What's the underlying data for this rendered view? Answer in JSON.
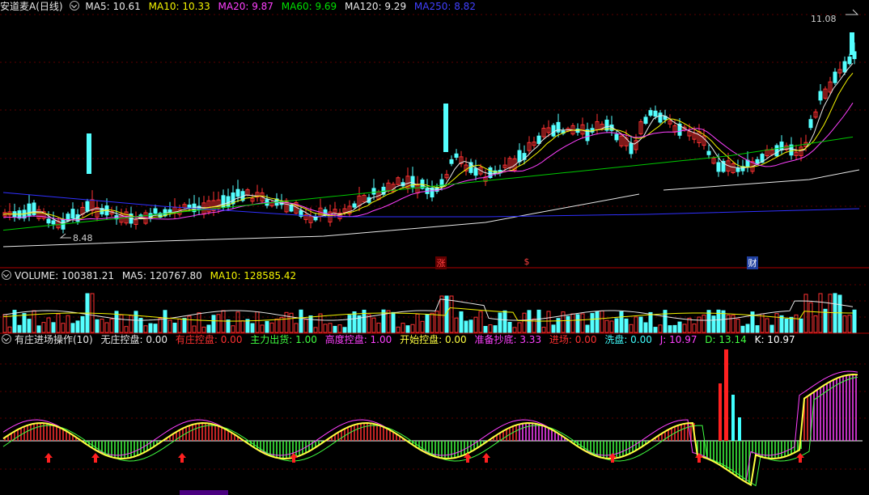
{
  "header1": {
    "title": "安道麦A(日线)",
    "items": [
      {
        "text": "MA5: 10.61",
        "color": "#e8e8e8"
      },
      {
        "text": "MA10: 10.33",
        "color": "#f4f400"
      },
      {
        "text": "MA20: 9.87",
        "color": "#ff40ff"
      },
      {
        "text": "MA60: 9.69",
        "color": "#00e000"
      },
      {
        "text": "MA120: 9.29",
        "color": "#e8e8e8"
      },
      {
        "text": "MA250: 8.82",
        "color": "#4040ff"
      }
    ]
  },
  "header2": {
    "title": "VOLUME: 100381.21",
    "items": [
      {
        "text": "MA5: 120767.80",
        "color": "#e8e8e8"
      },
      {
        "text": "MA10: 128585.42",
        "color": "#f4f400"
      }
    ]
  },
  "header3": {
    "title": "有庄进场操作(10)",
    "items": [
      {
        "text": "无庄控盘: 0.00",
        "color": "#e8e8e8"
      },
      {
        "text": "有庄控盘: 0.00",
        "color": "#ff3030"
      },
      {
        "text": "主力出货: 1.00",
        "color": "#40ff40"
      },
      {
        "text": "高度控盘: 1.00",
        "color": "#ff40ff"
      },
      {
        "text": "开始控盘: 0.00",
        "color": "#ffff40"
      },
      {
        "text": "准备抄底: 3.33",
        "color": "#ff40ff"
      },
      {
        "text": "进场: 0.00",
        "color": "#ff3030"
      },
      {
        "text": "洗盘: 0.00",
        "color": "#40ffff"
      },
      {
        "text": "J: 10.97",
        "color": "#ff40ff"
      },
      {
        "text": "D: 13.14",
        "color": "#40ff40"
      },
      {
        "text": "K: 10.97",
        "color": "#ffffff"
      }
    ]
  },
  "price": {
    "high_label": "11.08",
    "low_label": "8.48"
  },
  "markers": [
    {
      "text": "涨",
      "color": "#ff4040",
      "bg": "#600000"
    },
    {
      "text": "$",
      "color": "#ff4040",
      "bg": "#000000"
    },
    {
      "text": "财",
      "color": "#ffffff",
      "bg": "#2040a0"
    }
  ],
  "colors": {
    "up": "#ff3232",
    "down": "#54ffff",
    "divider": "#b00000",
    "grid": "#5a0000"
  }
}
